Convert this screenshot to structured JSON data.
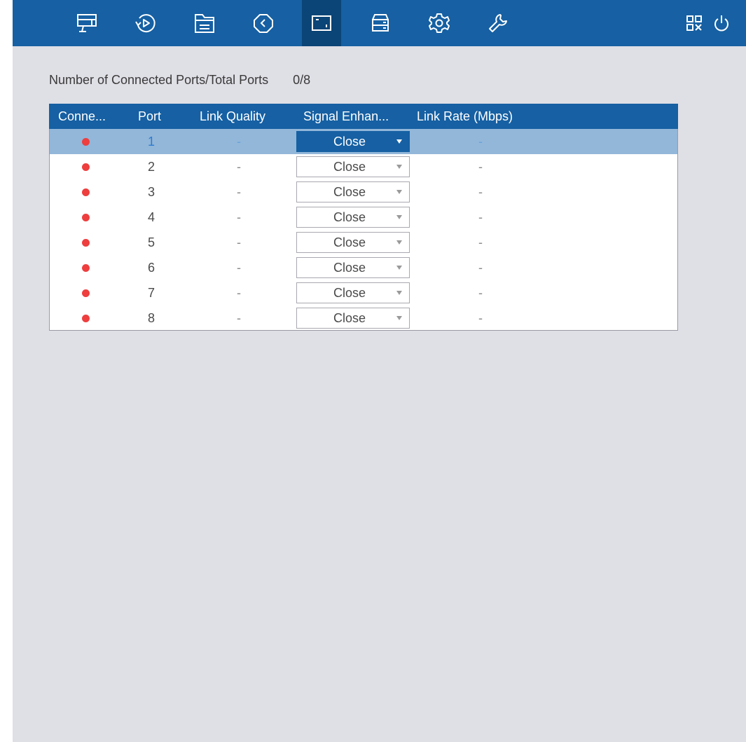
{
  "nav": {
    "items": [
      {
        "name": "live-view",
        "icon": "monitor-icon"
      },
      {
        "name": "playback",
        "icon": "playback-icon"
      },
      {
        "name": "file-management",
        "icon": "file-icon"
      },
      {
        "name": "smart-analysis",
        "icon": "smart-icon"
      },
      {
        "name": "camera",
        "icon": "camera-port-icon",
        "active": true
      },
      {
        "name": "storage",
        "icon": "storage-icon"
      },
      {
        "name": "configuration",
        "icon": "gear-icon"
      },
      {
        "name": "maintenance",
        "icon": "wrench-icon"
      }
    ],
    "utility": [
      "qr-code-icon",
      "power-icon"
    ],
    "accent": "#1660a3",
    "active_bg": "#0b4476"
  },
  "summary": {
    "label": "Number of Connected Ports/Total Ports",
    "value": "0/8"
  },
  "table": {
    "headers": [
      "Conne...",
      "Port",
      "Link Quality",
      "Signal Enhan...",
      "Link Rate (Mbps)"
    ],
    "rows": [
      {
        "status": "disconnected",
        "port": "1",
        "link_quality": "-",
        "signal_enhancement": "Close",
        "link_rate": "-",
        "selected": true
      },
      {
        "status": "disconnected",
        "port": "2",
        "link_quality": "-",
        "signal_enhancement": "Close",
        "link_rate": "-"
      },
      {
        "status": "disconnected",
        "port": "3",
        "link_quality": "-",
        "signal_enhancement": "Close",
        "link_rate": "-"
      },
      {
        "status": "disconnected",
        "port": "4",
        "link_quality": "-",
        "signal_enhancement": "Close",
        "link_rate": "-"
      },
      {
        "status": "disconnected",
        "port": "5",
        "link_quality": "-",
        "signal_enhancement": "Close",
        "link_rate": "-"
      },
      {
        "status": "disconnected",
        "port": "6",
        "link_quality": "-",
        "signal_enhancement": "Close",
        "link_rate": "-"
      },
      {
        "status": "disconnected",
        "port": "7",
        "link_quality": "-",
        "signal_enhancement": "Close",
        "link_rate": "-"
      },
      {
        "status": "disconnected",
        "port": "8",
        "link_quality": "-",
        "signal_enhancement": "Close",
        "link_rate": "-"
      }
    ],
    "status_color": "#ee3e3e"
  }
}
